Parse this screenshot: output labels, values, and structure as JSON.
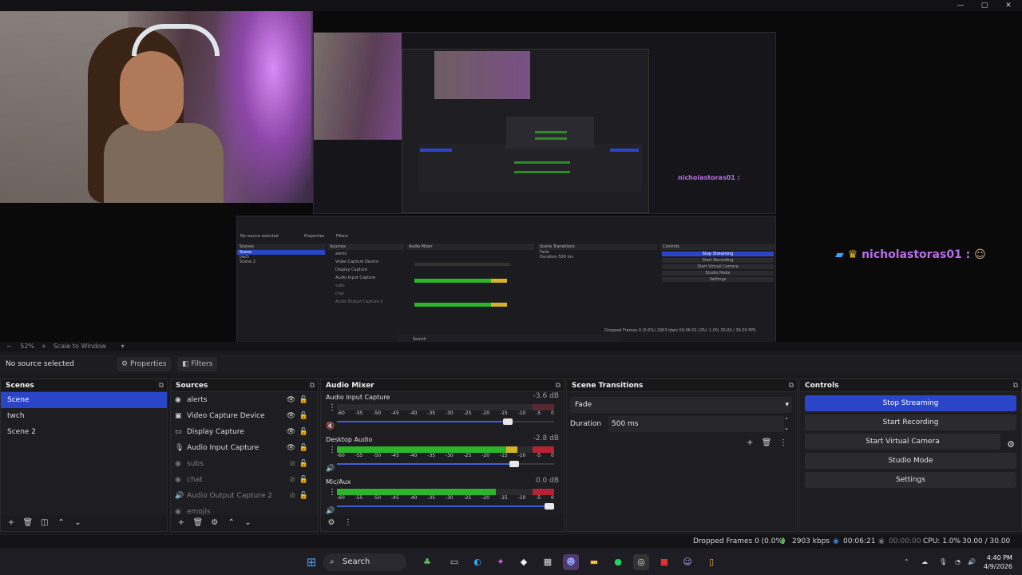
{
  "window": {
    "controls": [
      "—",
      "▢",
      "✕"
    ]
  },
  "preview": {
    "chat_user": "nicholastoras01 :",
    "nested_chat_user": "nicholastoras01 :",
    "nested_scenes_title": "Scenes",
    "nested_sources_title": "Sources",
    "nested_mixer_title": "Audio Mixer",
    "nested_transitions_title": "Scene Transitions",
    "nested_controls_title": "Controls",
    "nested_no_source": "No source selected",
    "nested_properties": "Properties",
    "nested_filters": "Filters",
    "nested_scenes": [
      "Scene",
      "twch",
      "Scene 2"
    ],
    "nested_sources": [
      "alerts",
      "Video Capture Device",
      "Display Capture",
      "Audio Input Capture",
      "subs",
      "chat",
      "Audio Output Capture 2"
    ],
    "nested_controls": [
      "Stop Streaming",
      "Start Recording",
      "Start Virtual Camera",
      "Studio Mode",
      "Settings"
    ],
    "nested_fade": "Fade",
    "nested_duration_label": "Duration",
    "nested_duration": "500 ms",
    "nested_search": "Search",
    "nested_status": "Dropped Frames 0 (0.0%)   2903 kbps   00:06:01   CPU: 1.0%   30.00 / 30.00 FPS"
  },
  "zoom": {
    "level": "52%",
    "mode": "Scale to Window"
  },
  "toolbar": {
    "no_source": "No source selected",
    "properties": "Properties",
    "filters": "Filters"
  },
  "scenes": {
    "title": "Scenes",
    "items": [
      "Scene",
      "twch",
      "Scene 2"
    ],
    "selected": 0
  },
  "sources": {
    "title": "Sources",
    "items": [
      {
        "label": "alerts",
        "icon": "browser-icon",
        "visible": true
      },
      {
        "label": "Video Capture Device",
        "icon": "camera-icon",
        "visible": true
      },
      {
        "label": "Display Capture",
        "icon": "monitor-icon",
        "visible": true
      },
      {
        "label": "Audio Input Capture",
        "icon": "mic-icon",
        "visible": true
      },
      {
        "label": "subs",
        "icon": "browser-icon",
        "visible": false
      },
      {
        "label": "chat",
        "icon": "browser-icon",
        "visible": false
      },
      {
        "label": "Audio Output Capture 2",
        "icon": "speaker-icon",
        "visible": false
      },
      {
        "label": "emojis",
        "icon": "browser-icon",
        "visible": false
      }
    ]
  },
  "mixer": {
    "title": "Audio Mixer",
    "ticks": [
      "-60",
      "-55",
      "-50",
      "-45",
      "-40",
      "-35",
      "-30",
      "-25",
      "-20",
      "-15",
      "-10",
      "-5",
      "0"
    ],
    "channels": [
      {
        "name": "Audio Input Capture",
        "db": "-3.6 dB",
        "level": 0,
        "fader": 0.81,
        "muted": true
      },
      {
        "name": "Desktop Audio",
        "db": "-2.8 dB",
        "level": 0.83,
        "fader": 0.84,
        "muted": false
      },
      {
        "name": "Mic/Aux",
        "db": "0.0 dB",
        "level": 0.73,
        "fader": 1.0,
        "muted": false
      }
    ]
  },
  "transitions": {
    "title": "Scene Transitions",
    "type": "Fade",
    "duration_label": "Duration",
    "duration": "500 ms"
  },
  "controls": {
    "title": "Controls",
    "buttons": [
      "Stop Streaming",
      "Start Recording",
      "Start Virtual Camera",
      "Studio Mode",
      "Settings"
    ]
  },
  "status": {
    "dropped": "Dropped Frames 0 (0.0%)",
    "bitrate": "2903 kbps",
    "stream_time": "00:06:21",
    "rec_time": "00:00:00",
    "cpu": "CPU: 1.0%",
    "fps": "30.00 / 30.00 FPS"
  },
  "taskbar": {
    "search": "Search",
    "time": "4:40 PM",
    "date": "4/9/2026"
  }
}
